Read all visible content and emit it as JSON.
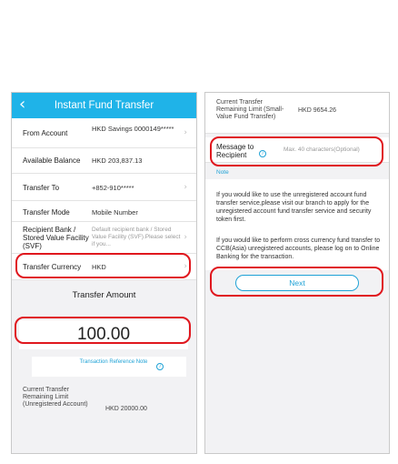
{
  "header": {
    "title": "Instant Fund Transfer"
  },
  "form": {
    "from_account": {
      "label": "From Account",
      "value": "HKD Savings 0000149*****"
    },
    "available_balance": {
      "label": "Available Balance",
      "value": "HKD  203,837.13"
    },
    "transfer_to": {
      "label": "Transfer To",
      "value": "+852-910*****"
    },
    "transfer_mode": {
      "label": "Transfer Mode",
      "value": "Mobile Number"
    },
    "recipient_bank": {
      "label": "Recipient Bank / Stored Value Facility (SVF)",
      "placeholder": "Default recipient bank / Stored Value Facility (SVF).Please select if you..."
    },
    "transfer_currency": {
      "label": "Transfer Currency",
      "value": "HKD"
    },
    "transfer_amount": {
      "label": "Transfer Amount",
      "value": "100.00"
    },
    "transaction_reference": {
      "label": "Transaction Reference Note"
    },
    "unregistered_limit": {
      "label": "Current Transfer Remaining Limit (Unregistered Account)",
      "value": "HKD 20000.00"
    }
  },
  "right": {
    "svf_limit": {
      "label": "Current Transfer Remaining Limit (Small-Value Fund Transfer)",
      "value": "HKD 9654.26"
    },
    "message": {
      "label": "Message to Recipient",
      "placeholder": "Max. 40 characters(Optional)"
    },
    "note_heading": "Note",
    "note_1": "If you would like to use the unregistered account fund transfer service,please visit our branch to apply for the unregistered account fund transfer service and security token first.",
    "note_2": "If you would like to perform cross currency fund transfer to CCB(Asia) unregistered accounts, please log on to Online Banking for the transaction.",
    "next_label": "Next"
  },
  "icons": {
    "back": "back-chevron-icon",
    "chevron": "chevron-right-icon",
    "info": "info-icon"
  },
  "colors": {
    "header": "#1fb3e8",
    "accent": "#1fa2d6",
    "highlight": "#e0171e"
  }
}
